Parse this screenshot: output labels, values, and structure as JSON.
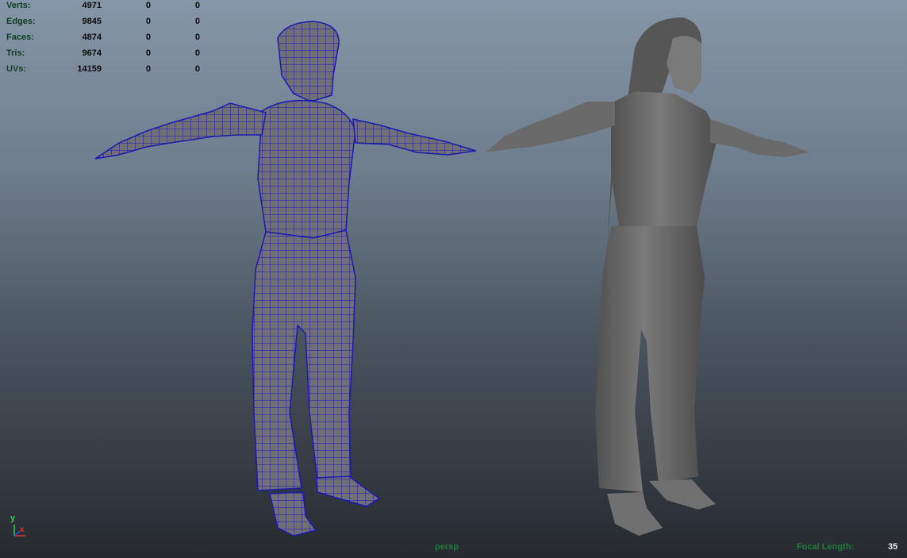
{
  "hud": {
    "rows": [
      {
        "label": "Verts:",
        "c1": "4971",
        "c2": "0",
        "c3": "0"
      },
      {
        "label": "Edges:",
        "c1": "9845",
        "c2": "0",
        "c3": "0"
      },
      {
        "label": "Faces:",
        "c1": "4874",
        "c2": "0",
        "c3": "0"
      },
      {
        "label": "Tris:",
        "c1": "9674",
        "c2": "0",
        "c3": "0"
      },
      {
        "label": "UVs:",
        "c1": "14159",
        "c2": "0",
        "c3": "0"
      }
    ]
  },
  "viewport": {
    "camera": "persp",
    "focal_label": "Focal Length:",
    "focal_value": "35"
  },
  "axes": {
    "y": "y",
    "x": "x"
  },
  "colors": {
    "wire": "#1a1ab0",
    "mesh_fill": "#6e6e6e",
    "hud_label": "#0f3d23",
    "hud_text_green": "#1f7a3d"
  },
  "icons": [
    "axis-gizmo-icon"
  ]
}
